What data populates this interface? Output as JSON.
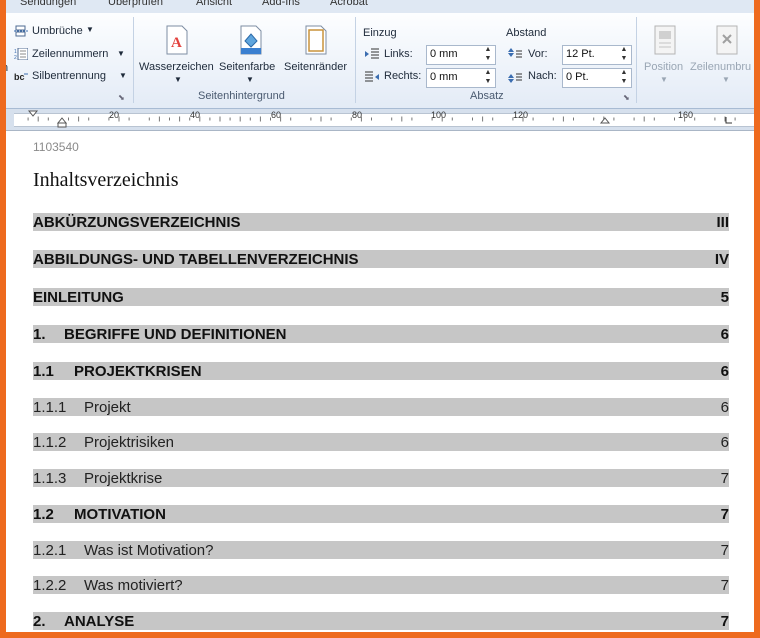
{
  "ribbon": {
    "tabs": [
      "Sendungen",
      "Überprüfen",
      "Ansicht",
      "Add-Ins",
      "Acrobat"
    ],
    "seitenlayout": {
      "umbrueche": "Umbrüche",
      "zeilennummern": "Zeilennummern",
      "silbentrennung": "Silbentrennung"
    },
    "seitenhintergrund": {
      "wasserzeichen": "Wasserzeichen",
      "seitenfarbe": "Seitenfarbe",
      "seitenraender": "Seitenränder",
      "group_label": "Seitenhintergrund"
    },
    "absatz": {
      "einzug_label": "Einzug",
      "links_label": "Links:",
      "links_value": "0 mm",
      "rechts_label": "Rechts:",
      "rechts_value": "0 mm",
      "abstand_label": "Abstand",
      "vor_label": "Vor:",
      "vor_value": "12 Pt.",
      "nach_label": "Nach:",
      "nach_value": "0 Pt.",
      "group_label": "Absatz"
    },
    "anordnen": {
      "position": "Position",
      "zeilenumbruch": "Zeilenumbru"
    }
  },
  "ruler": {
    "labels": [
      "20",
      "40",
      "60",
      "80",
      "100",
      "120",
      "160"
    ]
  },
  "document": {
    "id": "1103540",
    "title": "Inhaltsverzeichnis",
    "toc": [
      {
        "num": "",
        "label": "ABKÜRZUNGSVERZEICHNIS",
        "page": "III",
        "bold": true
      },
      {
        "num": "",
        "label": "ABBILDUNGS- UND TABELLENVERZEICHNIS",
        "page": "IV",
        "bold": true
      },
      {
        "num": "",
        "label": "EINLEITUNG",
        "page": "5",
        "bold": true
      },
      {
        "num": "1.",
        "label": "BEGRIFFE UND DEFINITIONEN",
        "page": "6",
        "bold": true
      },
      {
        "num": "1.1",
        "label": "PROJEKTKRISEN",
        "page": "6",
        "bold": true
      },
      {
        "num": "1.1.1",
        "label": "Projekt",
        "page": "6",
        "bold": false
      },
      {
        "num": "1.1.2",
        "label": "Projektrisiken",
        "page": "6",
        "bold": false
      },
      {
        "num": "1.1.3",
        "label": "Projektkrise",
        "page": "7",
        "bold": false
      },
      {
        "num": "1.2",
        "label": "MOTIVATION",
        "page": "7",
        "bold": true
      },
      {
        "num": "1.2.1",
        "label": "Was ist Motivation?",
        "page": "7",
        "bold": false
      },
      {
        "num": "1.2.2",
        "label": "Was motiviert?",
        "page": "7",
        "bold": false
      },
      {
        "num": "2.",
        "label": "ANALYSE",
        "page": "7",
        "bold": true
      }
    ]
  }
}
